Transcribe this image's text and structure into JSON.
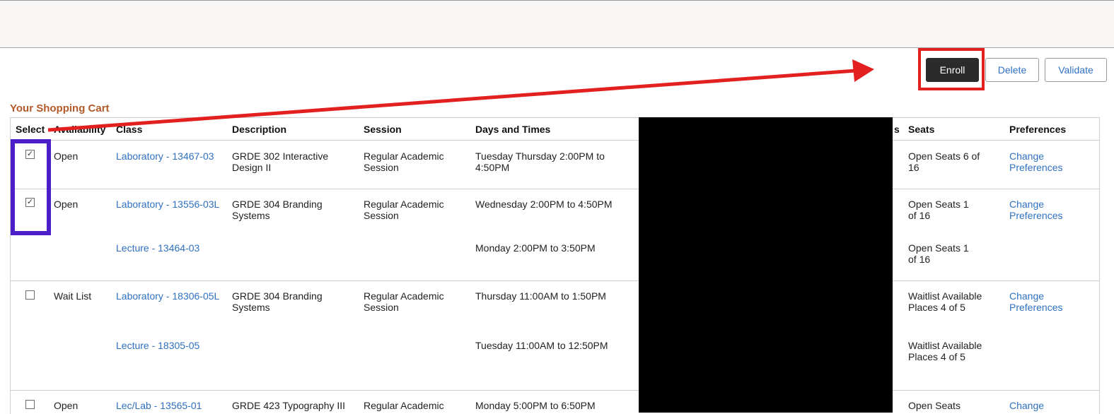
{
  "toolbar": {
    "enroll_label": "Enroll",
    "delete_label": "Delete",
    "validate_label": "Validate"
  },
  "cart": {
    "title": "Your Shopping Cart",
    "columns": {
      "select": "Select",
      "availability": "Availability",
      "class": "Class",
      "description": "Description",
      "session": "Session",
      "days_times": "Days and Times",
      "units_fragment": "s",
      "seats": "Seats",
      "preferences": "Preferences"
    },
    "rows": [
      {
        "selected": true,
        "availability": "Open",
        "class": "Laboratory - 13467-03",
        "description": "GRDE 302 Interactive Design II",
        "session": "Regular Academic Session",
        "days_times": "Tuesday Thursday   2:00PM to 4:50PM",
        "seats": "Open Seats 6 of 16",
        "preferences": "Change Preferences"
      },
      {
        "selected": true,
        "availability": "Open",
        "class": "Laboratory - 13556-03L",
        "description": "GRDE 304 Branding Systems",
        "session": "Regular Academic Session",
        "days_times": "Wednesday   2:00PM to 4:50PM",
        "seats": "Open Seats 1 of 16",
        "preferences": "Change Preferences",
        "sub": {
          "class": "Lecture - 13464-03",
          "days_times": "Monday   2:00PM to 3:50PM",
          "seats": "Open Seats 1 of 16"
        }
      },
      {
        "selected": false,
        "availability": "Wait List",
        "class": "Laboratory - 18306-05L",
        "description": "GRDE 304 Branding Systems",
        "session": "Regular Academic Session",
        "days_times": "Thursday   11:00AM to 1:50PM",
        "seats": "Waitlist Available Places 4 of 5",
        "preferences": "Change Preferences",
        "sub": {
          "class": "Lecture - 18305-05",
          "days_times": "Tuesday   11:00AM to 12:50PM",
          "seats": "Waitlist Available Places 4 of 5"
        }
      },
      {
        "selected": false,
        "availability": "Open",
        "class": "Lec/Lab - 13565-01",
        "description": "GRDE 423 Typography III",
        "session": "Regular Academic",
        "days_times": "Monday   5:00PM to 6:50PM",
        "seats": "Open Seats",
        "preferences": "Change"
      }
    ]
  },
  "colors": {
    "enroll_bg": "#2b2b2b",
    "link": "#2f70c0",
    "title": "#b25a2a",
    "annotation_red": "#e32020",
    "annotation_purple": "#4a1ec8"
  }
}
